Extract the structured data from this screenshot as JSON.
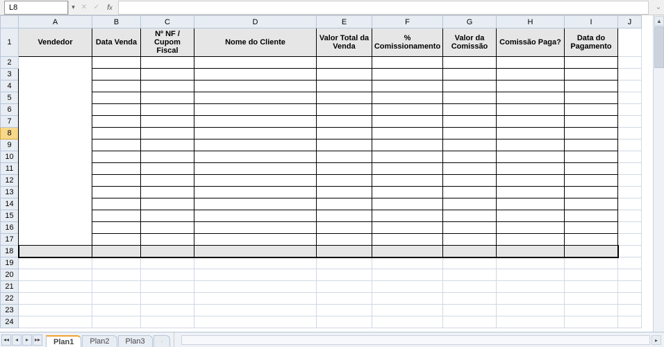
{
  "formula_bar": {
    "name_box_value": "L8",
    "fx_label_f": "f",
    "fx_label_x": "x",
    "formula_value": ""
  },
  "columns": [
    "A",
    "B",
    "C",
    "D",
    "E",
    "F",
    "G",
    "H",
    "I",
    "J"
  ],
  "row_count": 24,
  "active_row": 8,
  "template_headers": {
    "A": "Vendedor",
    "B": "Data Venda",
    "C": "Nº NF / Cupom Fiscal",
    "D": "Nome do Cliente",
    "E": "Valor Total da Venda",
    "F": "% Comissionamento",
    "G": "Valor da Comissão",
    "H": "Comissão Paga?",
    "I": "Data do Pagamento"
  },
  "sheet_tabs": {
    "tabs": [
      "Plan1",
      "Plan2",
      "Plan3"
    ],
    "active": "Plan1"
  },
  "chart_data": {
    "type": "table",
    "headers": [
      "Vendedor",
      "Data Venda",
      "Nº NF / Cupom Fiscal",
      "Nome do Cliente",
      "Valor Total da Venda",
      "% Comissionamento",
      "Valor da Comissão",
      "Comissão Paga?",
      "Data do Pagamento"
    ],
    "rows": []
  }
}
